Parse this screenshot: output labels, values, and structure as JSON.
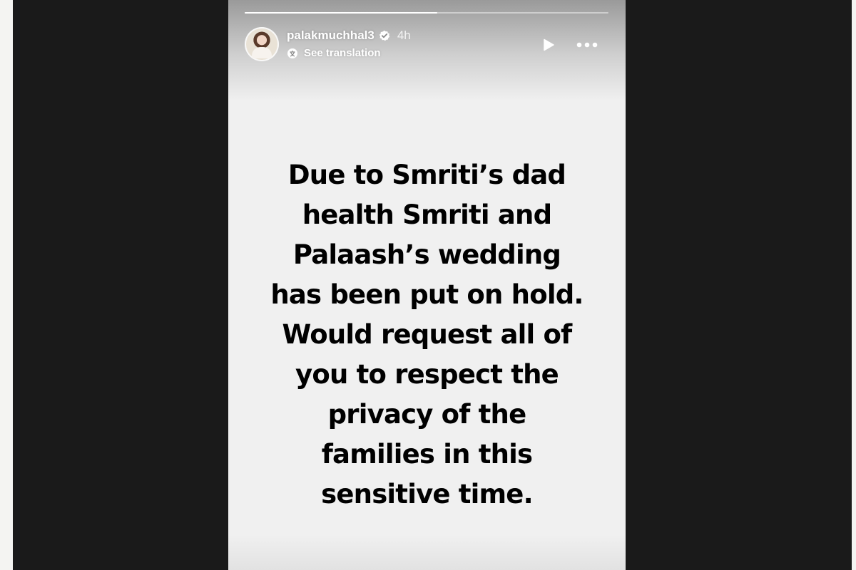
{
  "story": {
    "progress_fraction": 0.53,
    "header": {
      "username": "palakmuchhal3",
      "verified": true,
      "time": "4h",
      "translation_label": "See translation",
      "icons": {
        "verified": "verified-badge-icon",
        "translate": "translate-icon",
        "play": "play-icon",
        "more": "more-options-icon"
      }
    },
    "text_lines": [
      "Due to Smriti’s dad",
      "health Smriti and",
      "Palaash’s wedding",
      "has been put on hold.",
      "Would request all of",
      "you to respect the",
      "privacy of the",
      "families in this",
      "sensitive time."
    ]
  },
  "colors": {
    "page_background": "#1a1a1a",
    "story_background": "#f0f0f0",
    "text": "#000000",
    "overlay_text": "#ffffff"
  }
}
